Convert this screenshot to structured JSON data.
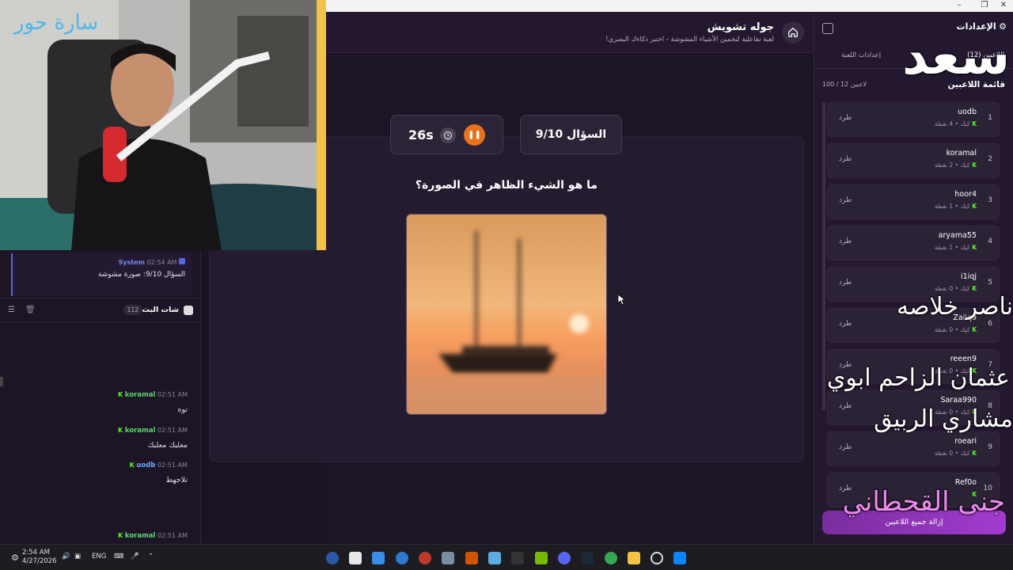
{
  "window": {
    "minimize": "–",
    "restore": "❐",
    "close": "✕"
  },
  "header": {
    "title": "جوله تشويش",
    "subtitle": "لعبة تفاعلية لتخمين الأشياء المشوشة - اختبر ذكاءك البصري!"
  },
  "game": {
    "question_counter": "السؤال 9/10",
    "timer": "26s",
    "question": "ما هو الشيء الظاهر في الصورة؟"
  },
  "webcam": {
    "overlay_name": "سارة حور"
  },
  "chat": {
    "system_user": "System",
    "system_time": "02:54 AM",
    "system_text": "السؤال 9/10: صورة مشوشة",
    "title": "شات البث",
    "count": "112",
    "messages": [
      {
        "user": "koramal",
        "time": "02:51 AM",
        "text": "توه"
      },
      {
        "user": "koramal",
        "time": "02:51 AM",
        "text": "معليك معليك"
      },
      {
        "user": "uodb",
        "time": "02:51 AM",
        "text": "تلاجهط"
      },
      {
        "user": "koramal",
        "time": "02:51 AM",
        "text": ""
      }
    ]
  },
  "sidebar": {
    "title": "الإعدادات",
    "tabs": [
      "اللاعبين (12)",
      "إعدادات اللعبة"
    ],
    "list_title": "قائمة اللاعبين",
    "capacity": "100 / 12 لاعبين",
    "kick_label": "طرد",
    "remove_all": "إزالة جميع اللاعبين",
    "players": [
      {
        "num": "1",
        "name": "uodb",
        "meta": "كيك • 4 نقطة"
      },
      {
        "num": "2",
        "name": "koramal",
        "meta": "كيك • 2 نقطة"
      },
      {
        "num": "3",
        "name": "hoor4",
        "meta": "كيك • 1 نقطة"
      },
      {
        "num": "4",
        "name": "aryama55",
        "meta": "كيك • 1 نقطة"
      },
      {
        "num": "5",
        "name": "i1iqj",
        "meta": "كيك • 0 نقطة"
      },
      {
        "num": "6",
        "name": "Zaiiq9",
        "meta": "كيك • 0 نقطة"
      },
      {
        "num": "7",
        "name": "reeen9",
        "meta": "كيك • 0 نقطة"
      },
      {
        "num": "8",
        "name": "Saraa990",
        "meta": "كيك • 0 نقطة"
      },
      {
        "num": "9",
        "name": "roeari",
        "meta": "كيك • 0 نقطة"
      },
      {
        "num": "10",
        "name": "Ref0o",
        "meta": ""
      }
    ]
  },
  "overlays": {
    "top": "سعد",
    "line1": "ناصر خلاصه",
    "line2": "عثمان الزاحم ابوي",
    "line3": "مشاري الربيق",
    "line4": "جنى القحطاني"
  },
  "taskbar": {
    "time": "2:54 AM",
    "date": "4/27/2026",
    "lang": "ENG"
  },
  "colors": {
    "accent": "#e8711b",
    "kick_green": "#53fc18",
    "purple": "#a23bd0"
  }
}
